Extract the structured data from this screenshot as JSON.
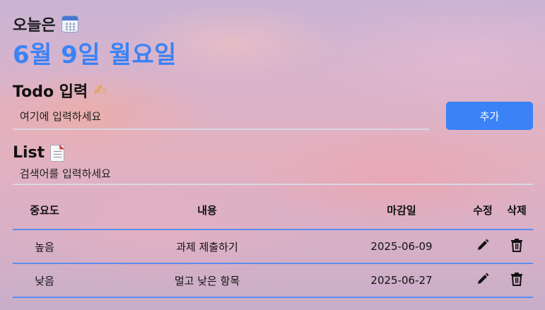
{
  "header": {
    "today_label": "오늘은",
    "date": "6월 9일 월요일"
  },
  "todo": {
    "title": "Todo 입력",
    "input_placeholder": "여기에 입력하세요",
    "add_label": "추가"
  },
  "list": {
    "title": "List",
    "search_placeholder": "검색어를 입력하세요",
    "columns": {
      "priority": "중요도",
      "content": "내용",
      "due": "마감일",
      "edit": "수정",
      "delete": "삭제"
    },
    "rows": [
      {
        "priority": "높음",
        "content": "과제 제출하기",
        "due": "2025-06-09"
      },
      {
        "priority": "낮음",
        "content": "멀고 낮은 항목",
        "due": "2025-06-27"
      }
    ]
  },
  "icons": {
    "calendar": "calendar-icon",
    "writing": "writing-hand-icon",
    "document": "document-icon",
    "edit": "pencil-icon",
    "delete": "trash-icon"
  },
  "colors": {
    "accent": "#3b82f6",
    "divider": "#5b8df0"
  }
}
